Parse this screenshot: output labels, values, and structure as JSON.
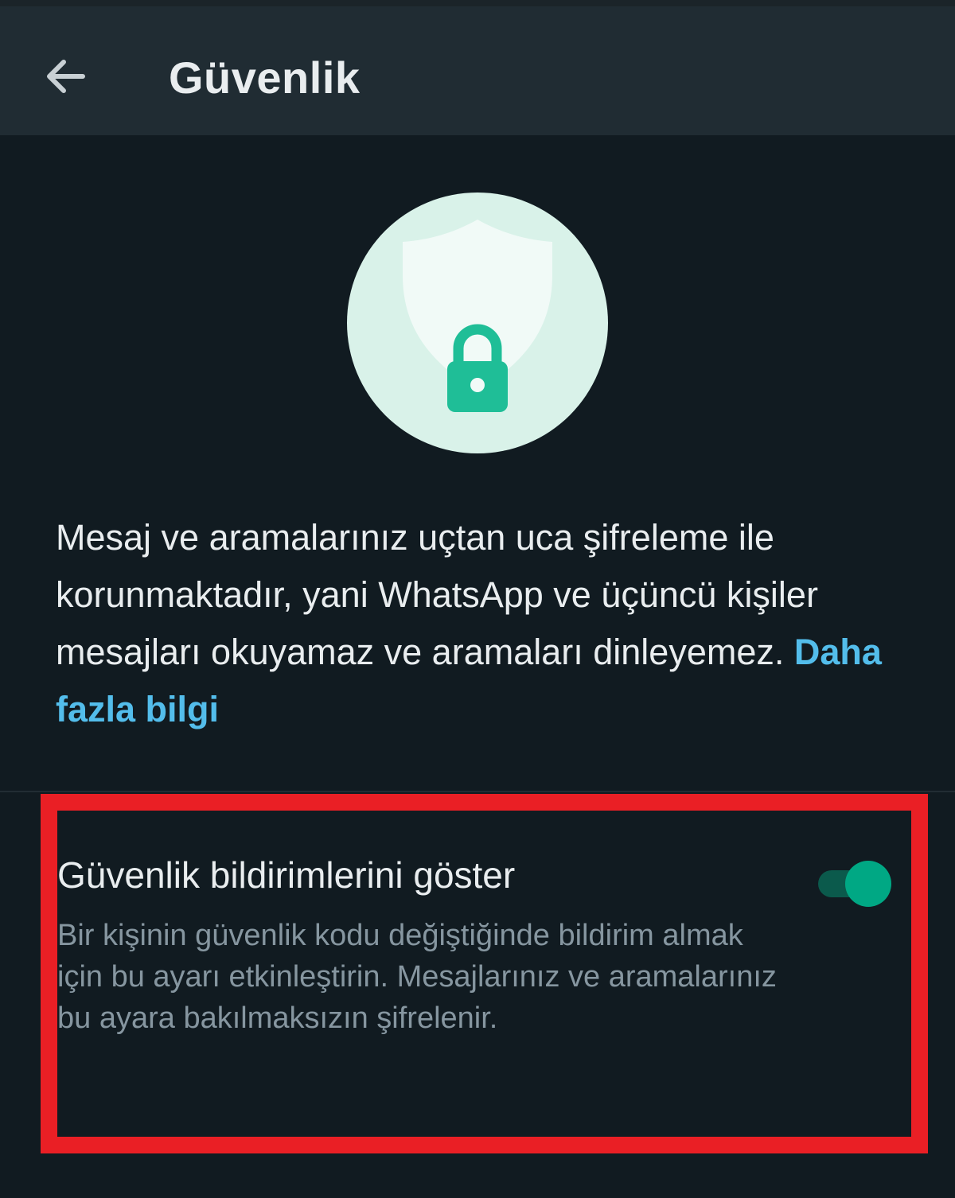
{
  "header": {
    "title": "Güvenlik",
    "back_icon": "arrow-left-icon"
  },
  "hero": {
    "icon": "shield-lock-icon",
    "circle_color": "#d9f2e9",
    "shield_color": "#f1faf7",
    "lock_color": "#1fbe97"
  },
  "info": {
    "text": "Mesaj ve aramalarınız uçtan uca şifreleme ile korunmaktadır, yani WhatsApp ve üçüncü kişiler mesajları okuyamaz ve aramaları dinleyemez.",
    "link": "Daha fazla bilgi"
  },
  "setting": {
    "title": "Güvenlik bildirimlerini göster",
    "description": "Bir kişinin güvenlik kodu değiştiğinde bildirim almak için bu ayarı etkinleştirin. Mesajlarınız ve aramalarınız bu ayara bakılmaksızın şifrelenir.",
    "enabled": true
  },
  "colors": {
    "background": "#111b21",
    "header_bg": "#202c33",
    "accent": "#00a884",
    "link": "#53bdeb",
    "highlight": "#ea1f25"
  }
}
